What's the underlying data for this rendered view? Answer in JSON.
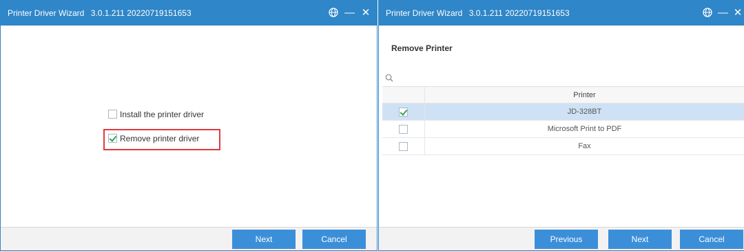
{
  "left_window": {
    "title": "Printer Driver Wizard",
    "version": "3.0.1.211  20220719151653",
    "options": [
      {
        "label": "Install the printer driver",
        "checked": false
      },
      {
        "label": "Remove printer driver",
        "checked": true
      }
    ],
    "buttons": {
      "next": "Next",
      "cancel": "Cancel"
    }
  },
  "right_window": {
    "title": "Printer Driver Wizard",
    "version": "3.0.1.211  20220719151653",
    "heading": "Remove Printer",
    "table": {
      "column_header": "Printer",
      "rows": [
        {
          "name": "JD-328BT",
          "checked": true,
          "selected": true
        },
        {
          "name": "Microsoft Print to PDF",
          "checked": false,
          "selected": false
        },
        {
          "name": "Fax",
          "checked": false,
          "selected": false
        }
      ]
    },
    "buttons": {
      "previous": "Previous",
      "next": "Next",
      "cancel": "Cancel"
    }
  },
  "icons": {
    "globe": "globe-icon",
    "minimize": "minimize-icon",
    "close": "close-icon",
    "search": "search-icon"
  },
  "colors": {
    "titlebar": "#2f86c8",
    "button": "#3b8fd9",
    "highlight": "#e0393e",
    "selected_row": "#cfe2f5",
    "check": "#2fa44f"
  }
}
